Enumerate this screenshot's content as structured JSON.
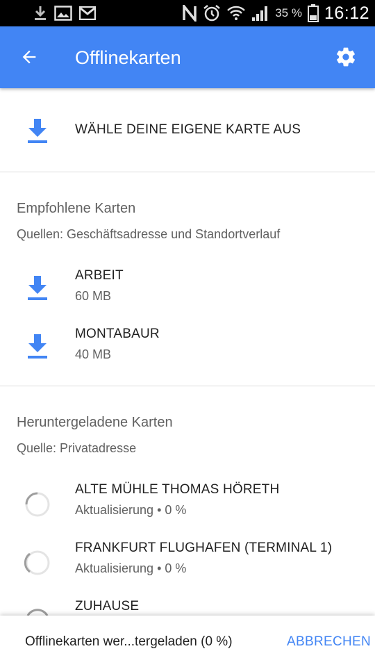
{
  "status_bar": {
    "battery_percent": "35 %",
    "time": "16:12",
    "left_icons": [
      "download-notification-icon",
      "image-notification-icon",
      "gmail-notification-icon"
    ],
    "right_icons": [
      "nfc-icon",
      "alarm-icon",
      "wifi-icon",
      "signal-icon",
      "battery-icon"
    ]
  },
  "app_bar": {
    "title": "Offlinekarten",
    "back_icon": "arrow-back-icon",
    "settings_icon": "gear-icon",
    "color": "#4285f4"
  },
  "choose_map": {
    "label": "WÄHLE DEINE EIGENE KARTE AUS",
    "icon": "download-icon"
  },
  "recommended": {
    "title": "Empfohlene Karten",
    "sources": "Quellen: Geschäftsadresse und Standortverlauf",
    "items": [
      {
        "name": "ARBEIT",
        "size": "60 MB",
        "icon": "download-icon"
      },
      {
        "name": "MONTABAUR",
        "size": "40 MB",
        "icon": "download-icon"
      }
    ]
  },
  "downloaded": {
    "title": "Heruntergeladene Karten",
    "source": "Quelle: Privatadresse",
    "items": [
      {
        "name": "ALTE MÜHLE THOMAS HÖRETH",
        "status": "Aktualisierung • 0 %",
        "progress": 0
      },
      {
        "name": "FRANKFURT FLUGHAFEN (TERMINAL 1)",
        "status": "Aktualisierung • 0 %",
        "progress": 0
      },
      {
        "name": "ZUHAUSE",
        "status": "",
        "progress": 0
      }
    ]
  },
  "snackbar": {
    "message": "Offlinekarten wer...tergeladen (0 %)",
    "action": "ABBRECHEN"
  },
  "colors": {
    "accent": "#4285f4",
    "divider": "#dcdcdc",
    "secondary_text": "#616161"
  }
}
